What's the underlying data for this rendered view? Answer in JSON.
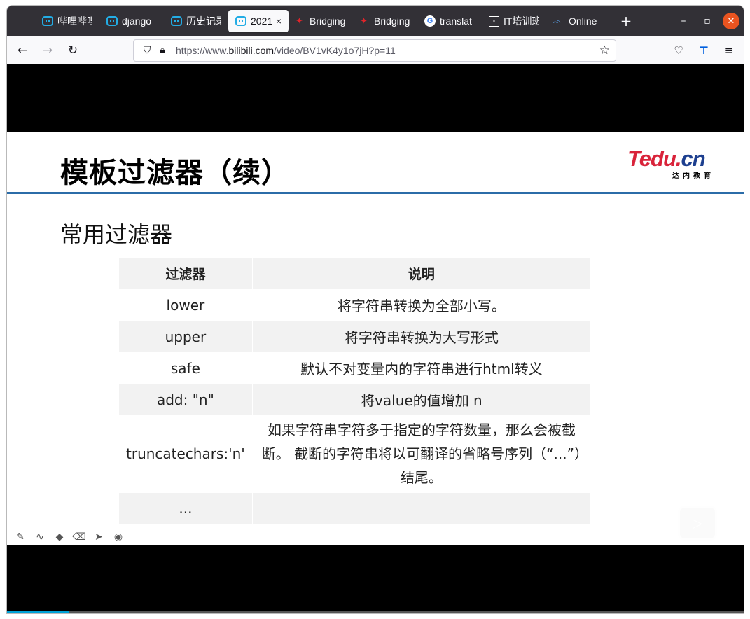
{
  "browser": {
    "tabs": [
      {
        "label": "哔哩哔哩",
        "icon": "bilibili-icon",
        "active": false
      },
      {
        "label": "django",
        "icon": "bilibili-icon",
        "active": false
      },
      {
        "label": "历史记录",
        "icon": "bilibili-icon",
        "active": false
      },
      {
        "label": "2021",
        "icon": "bilibili-icon",
        "active": true
      },
      {
        "label": "Bridging",
        "icon": "maple-leaf-icon",
        "active": false
      },
      {
        "label": "Bridging",
        "icon": "maple-leaf-icon",
        "active": false
      },
      {
        "label": "translat",
        "icon": "google-icon",
        "active": false
      },
      {
        "label": "IT培训班",
        "icon": "it-icon",
        "active": false
      },
      {
        "label": "Online",
        "icon": "cnblogs-icon",
        "active": false
      }
    ],
    "close_tab_glyph": "×",
    "new_tab_glyph": "+",
    "url": {
      "prefix": "https://www.",
      "domain": "bilibili.com",
      "path": "/video/BV1vK4y1o7jH?p=11"
    },
    "accent": "#e95420"
  },
  "slide": {
    "title": "模板过滤器（续）",
    "logo_brand": "Tedu.",
    "logo_brand_suffix": "cn",
    "logo_tagline": "达内教育",
    "section_heading": "常用过滤器",
    "table": {
      "headers": [
        "过滤器",
        "说明"
      ],
      "rows": [
        {
          "filter": "lower",
          "description": "将字符串转换为全部小写。"
        },
        {
          "filter": "upper",
          "description": "将字符串转换为大写形式"
        },
        {
          "filter": "safe",
          "description": "默认不对变量内的字符串进行html转义"
        },
        {
          "filter": "add: \"n\"",
          "description": "将value的值增加 n"
        },
        {
          "filter": "truncatechars:'n'",
          "description": "如果字符串字符多于指定的字符数量，那么会被截断。 截断的字符串将以可翻译的省略号序列（“...”）结尾。"
        },
        {
          "filter": "...",
          "description": ""
        }
      ]
    },
    "rule_color": "#2b6ca8"
  },
  "player": {
    "progress_fraction": 0.085,
    "progress_color": "#00a1d6"
  }
}
